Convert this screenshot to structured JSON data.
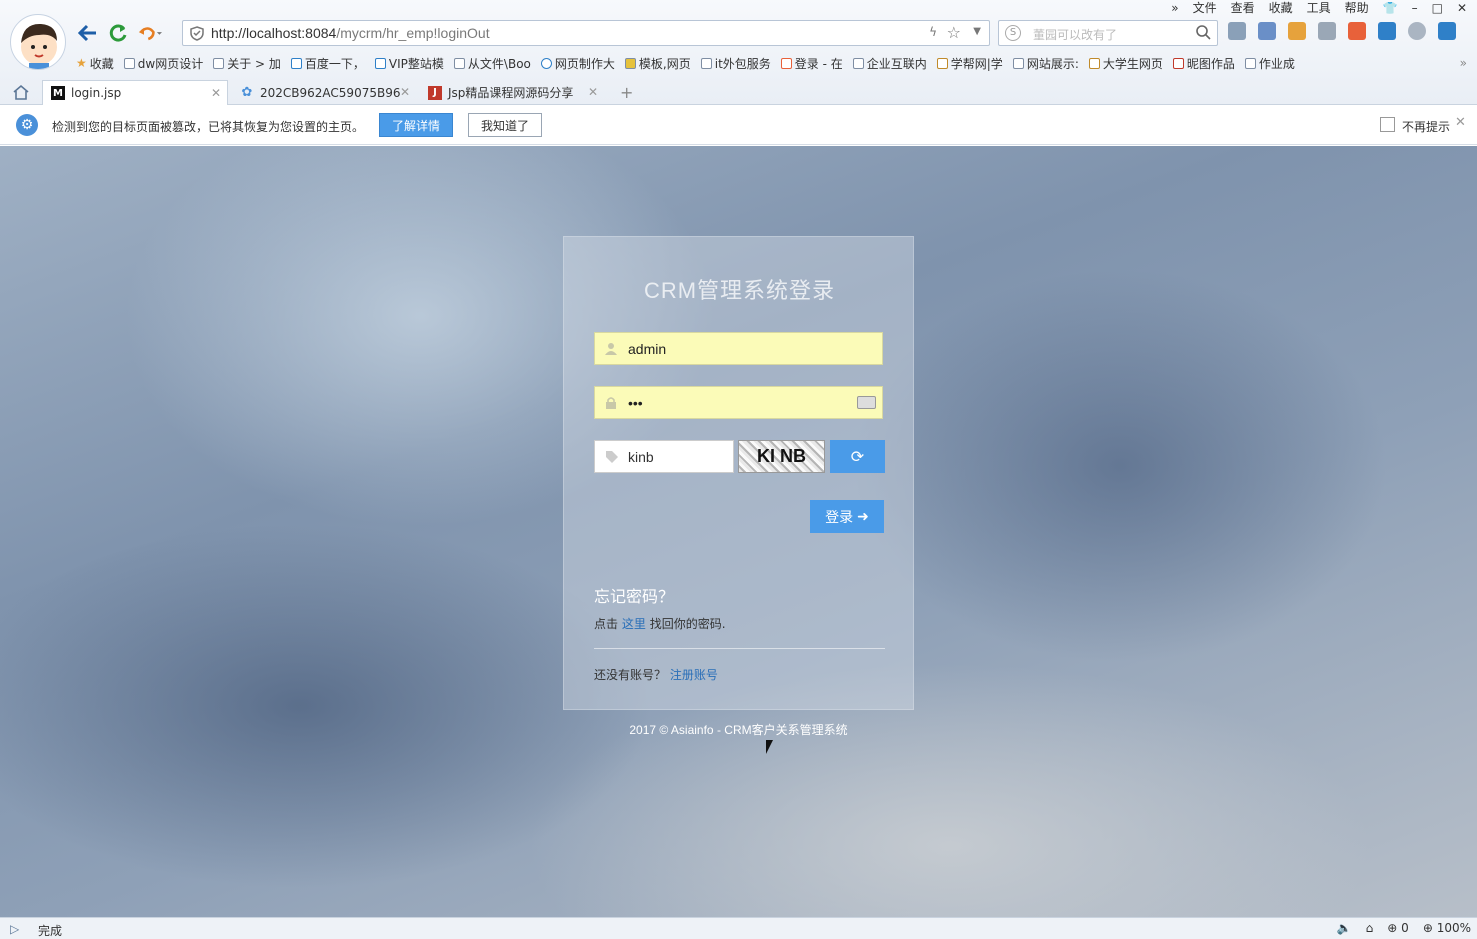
{
  "window": {
    "menu": [
      "»",
      "文件",
      "查看",
      "收藏",
      "工具",
      "帮助"
    ]
  },
  "addressbar": {
    "url_host": "http://localhost:8084",
    "url_path": "/mycrm/hr_emp!loginOut"
  },
  "search": {
    "placeholder": "董园可以改有了"
  },
  "bookmarks": [
    "收藏",
    "dw网页设计",
    "关于 > 加",
    "百度一下，",
    "VIP整站模",
    "从文件\\Boo",
    "网页制作大",
    "模板,网页",
    "it外包服务",
    "登录 - 在",
    "企业互联内",
    "学帮网|学",
    "网站展示:",
    "大学生网页",
    "昵图作品",
    "作业成"
  ],
  "tabs": [
    {
      "label": "login.jsp",
      "fav": "M",
      "fav_color": "#111111"
    },
    {
      "label": "202CB962AC59075B96",
      "fav": "✿",
      "fav_color": "#4a90d9"
    },
    {
      "label": "Jsp精品课程网源码分享",
      "fav": "J",
      "fav_color": "#c0392b"
    }
  ],
  "notify": {
    "message": "检测到您的目标页面被篡改，已将其恢复为您设置的主页。",
    "detail_button": "了解详情",
    "ok_button": "我知道了",
    "dont_show": "不再提示"
  },
  "login": {
    "title": "CRM管理系统登录",
    "username": "admin",
    "password": "•••",
    "captcha_value": "kinb",
    "captcha_image_text": "KI NB",
    "login_button": "登录",
    "forgot_title": "忘记密码？",
    "forgot_prefix": "点击",
    "forgot_link": "这里",
    "forgot_suffix": "找回你的密码.",
    "register_prefix": "还没有账号？",
    "register_link": "注册账号",
    "copyright": "2017 © Asiainfo - CRM客户关系管理系统"
  },
  "statusbar": {
    "status": "完成",
    "count": "0",
    "zoom": "100%"
  },
  "colors": {
    "accent": "#4a9be8",
    "field_bg": "#fbfbb8",
    "link": "#2a6fb8"
  }
}
